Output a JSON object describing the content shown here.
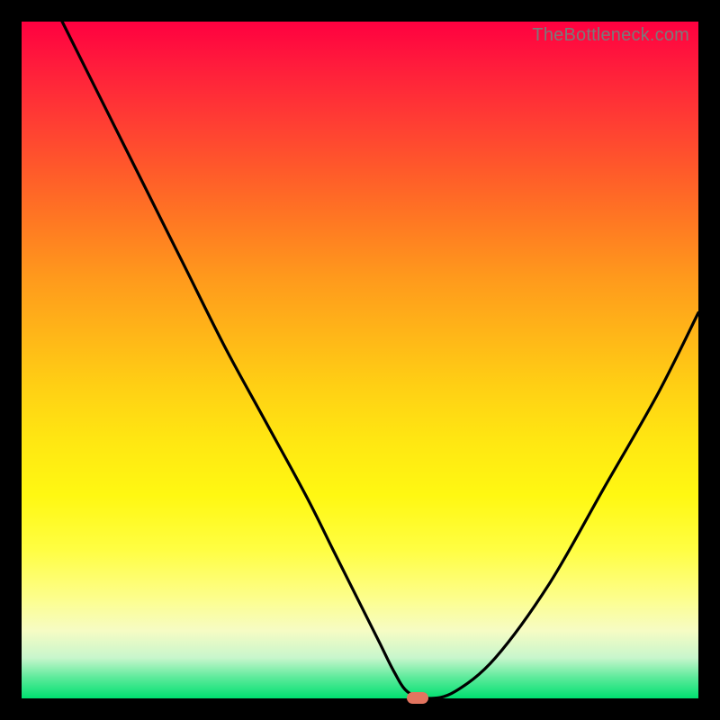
{
  "attribution": "TheBottleneck.com",
  "colors": {
    "frame_bg": "#000000",
    "curve_stroke": "#000000",
    "marker_fill": "#e2745f",
    "attribution_text": "#7a7a7a",
    "gradient_top": "#ff0040",
    "gradient_bottom": "#00e070"
  },
  "chart_data": {
    "type": "line",
    "title": "",
    "xlabel": "",
    "ylabel": "",
    "xlim": [
      0,
      100
    ],
    "ylim": [
      0,
      100
    ],
    "grid": false,
    "legend": false,
    "series": [
      {
        "name": "bottleneck-curve",
        "x": [
          6,
          12,
          18,
          24,
          30,
          36,
          42,
          46,
          50,
          53,
          55,
          57,
          60,
          64,
          70,
          78,
          86,
          94,
          100
        ],
        "values": [
          100,
          88,
          76,
          64,
          52,
          41,
          30,
          22,
          14,
          8,
          4,
          1,
          0,
          1,
          6,
          17,
          31,
          45,
          57
        ]
      }
    ],
    "optimum_marker": {
      "x": 58.5,
      "y": 0
    }
  }
}
